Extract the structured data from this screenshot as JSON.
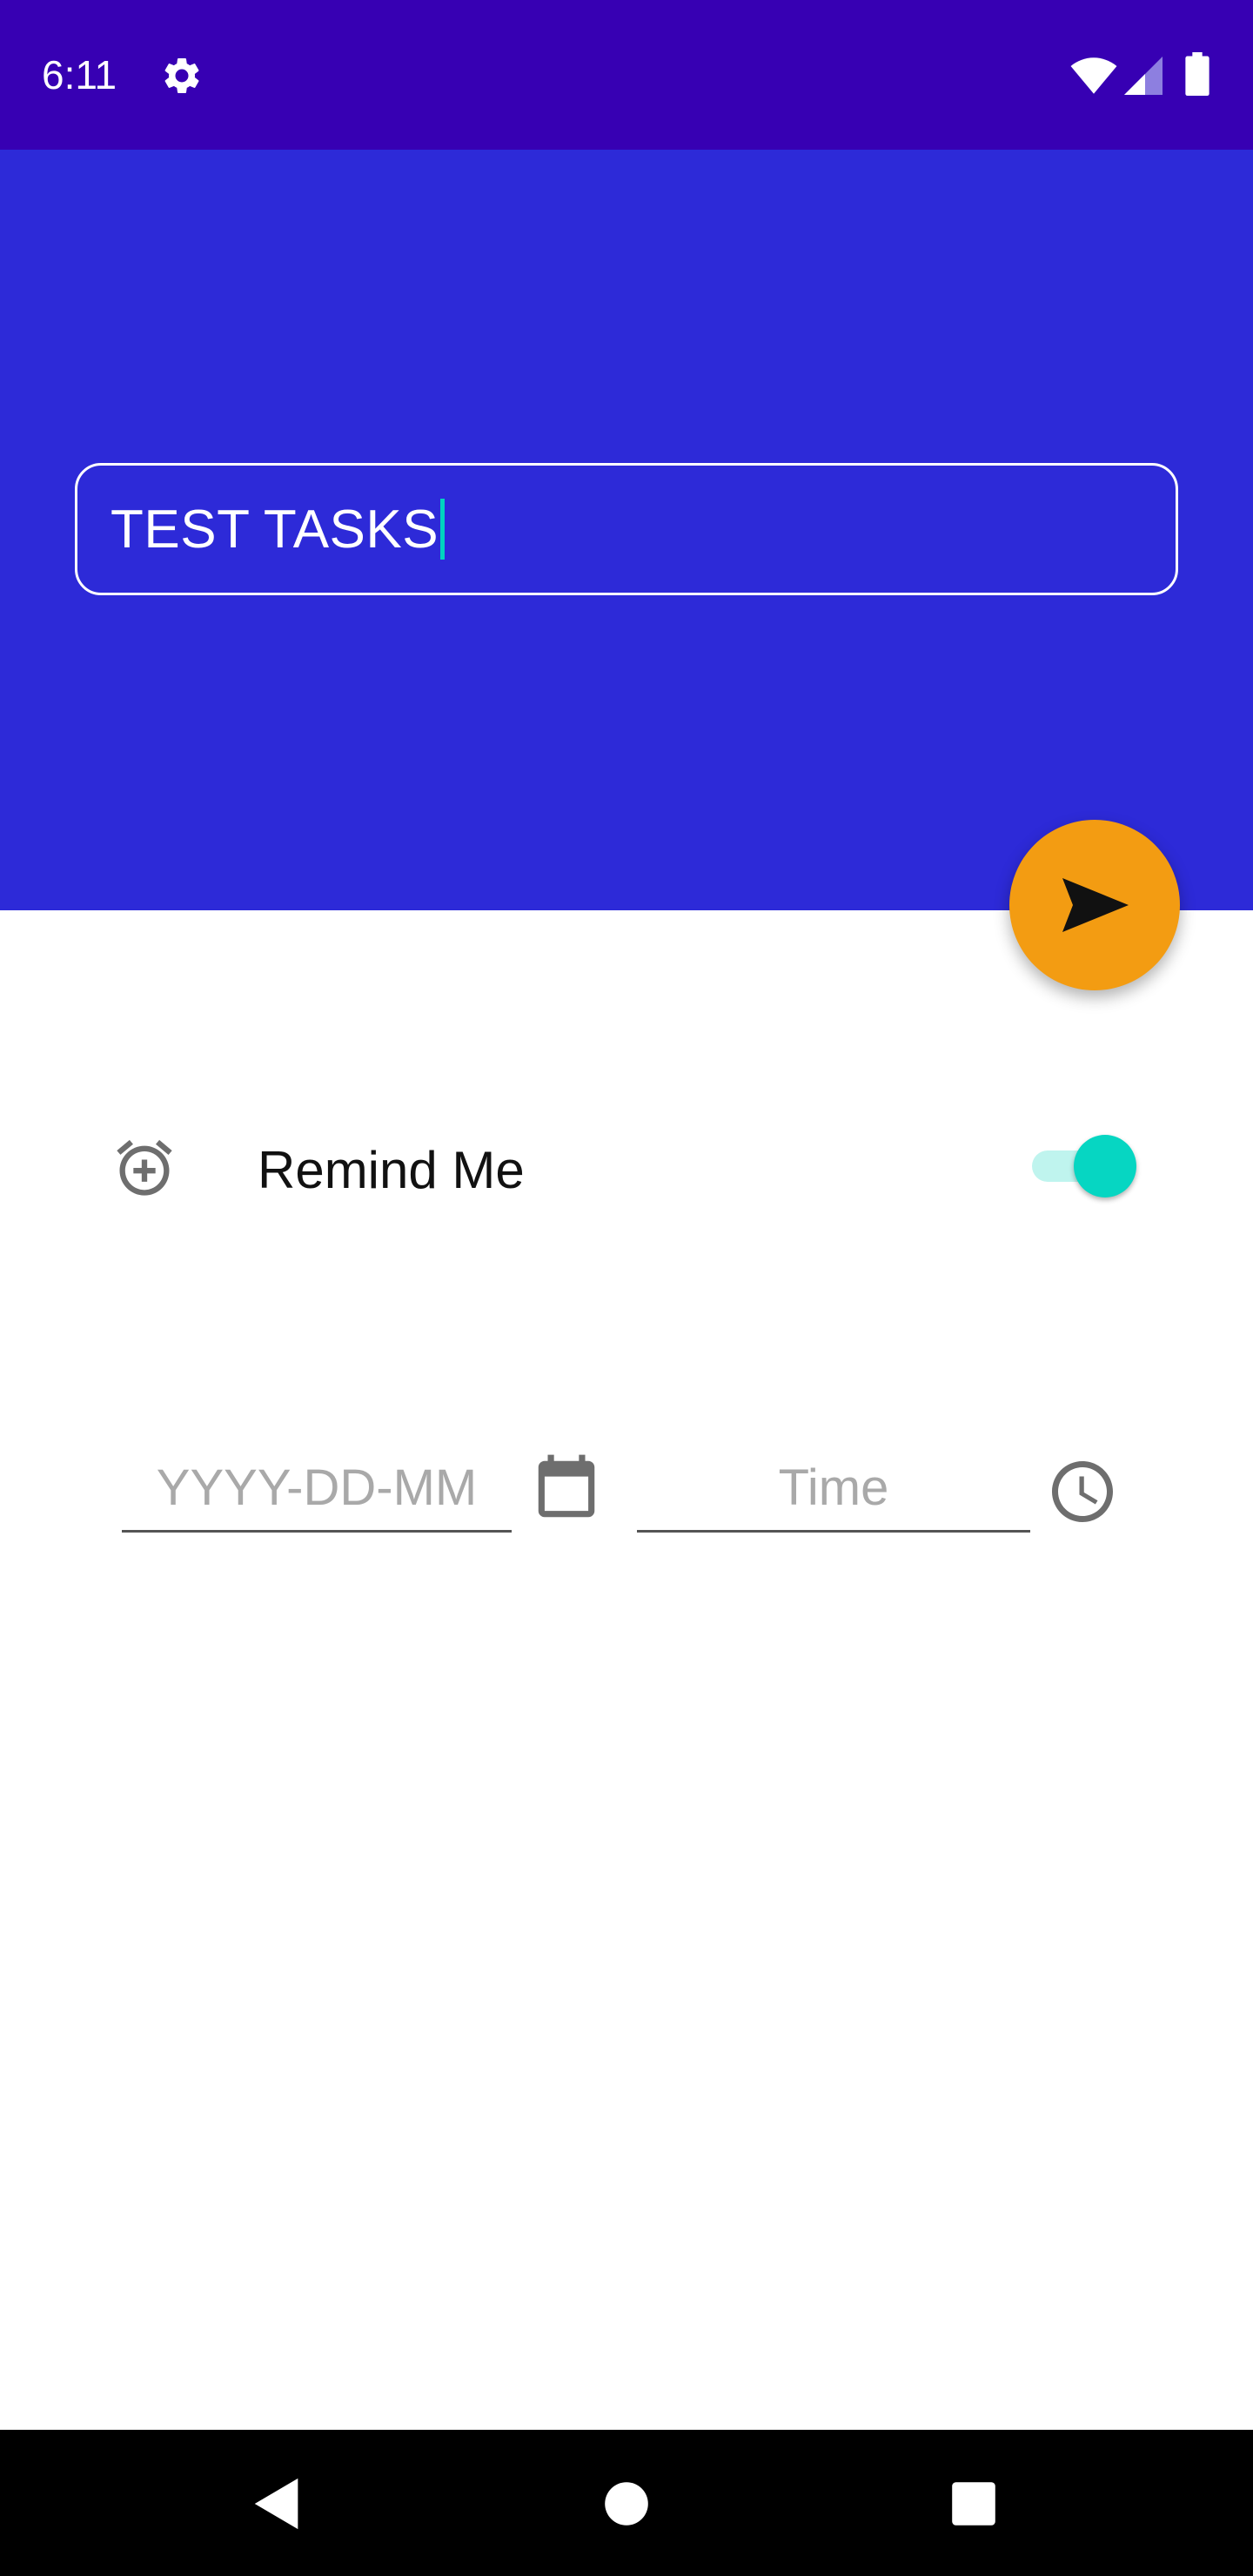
{
  "status_bar": {
    "time": "6:11",
    "icons": [
      "gear-icon",
      "wifi-icon",
      "signal-icon",
      "battery-icon"
    ]
  },
  "task_input": {
    "value": "TEST TASKS"
  },
  "fab": {
    "icon": "send-icon",
    "color": "#f39c12"
  },
  "reminder": {
    "label": "Remind Me",
    "icon": "alarm-add-icon",
    "enabled": true
  },
  "date_field": {
    "placeholder": "YYYY-DD-MM",
    "icon": "calendar-icon"
  },
  "time_field": {
    "placeholder": "Time",
    "icon": "clock-icon"
  },
  "nav_bar": {
    "icons": [
      "back-icon",
      "home-icon",
      "recents-icon"
    ]
  },
  "colors": {
    "status_bar": "#3700b3",
    "header": "#2d2ad8",
    "accent": "#06d6c2",
    "fab": "#f39c12"
  }
}
